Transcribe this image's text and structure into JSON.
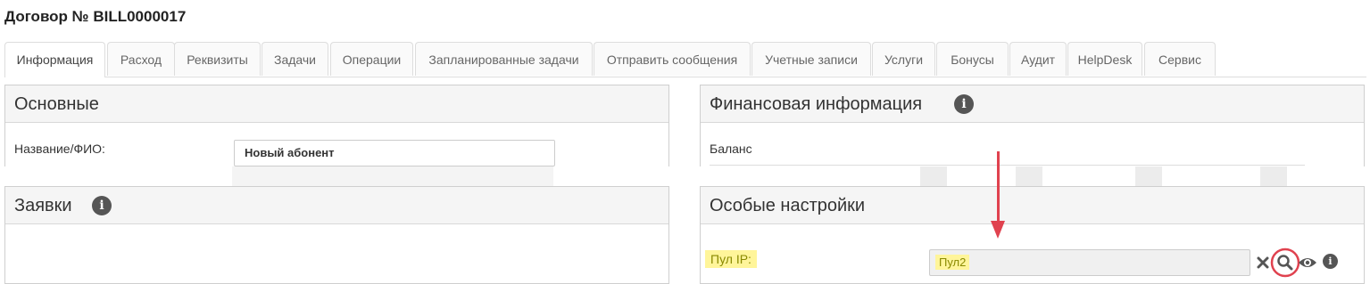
{
  "page_title": "Договор № BILL0000017",
  "tabs": [
    {
      "label": "Информация",
      "active": true
    },
    {
      "label": "Расход"
    },
    {
      "label": "Реквизиты"
    },
    {
      "label": "Задачи"
    },
    {
      "label": "Операции"
    },
    {
      "label": "Запланированные задачи"
    },
    {
      "label": "Отправить сообщения"
    },
    {
      "label": "Учетные записи"
    },
    {
      "label": "Услуги"
    },
    {
      "label": "Бонусы"
    },
    {
      "label": "Аудит"
    },
    {
      "label": "HelpDesk"
    },
    {
      "label": "Сервис"
    }
  ],
  "main_panel": {
    "title": "Основные",
    "name_label": "Название/ФИО:",
    "name_value": "Новый абонент"
  },
  "requests_panel": {
    "title": "Заявки",
    "info_icon": "i"
  },
  "finance_panel": {
    "title": "Финансовая информация",
    "info_icon": "i",
    "balance_label": "Баланс"
  },
  "special_panel": {
    "title": "Особые настройки",
    "ip_pool_label": "Пул IP:",
    "ip_pool_value": "Пул2",
    "icons": [
      "clear-icon",
      "search-icon",
      "view-icon",
      "info-icon"
    ],
    "info_icon": "i"
  },
  "colors": {
    "annotation_red": "#e0424f",
    "highlight_yellow": "#fff59a"
  }
}
